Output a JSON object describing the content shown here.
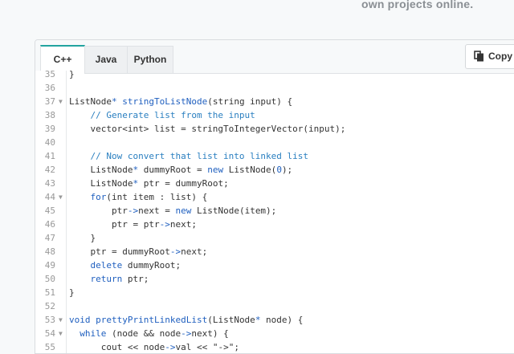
{
  "header_fragment": "own projects online.",
  "tabs": [
    {
      "label": "C++",
      "active": true
    },
    {
      "label": "Java",
      "active": false
    },
    {
      "label": "Python",
      "active": false
    }
  ],
  "copy_label": "Copy",
  "colors": {
    "accent": "#22a39f",
    "keyword": "#1f5fbf",
    "comment": "#2a7fc0"
  },
  "code_lines": [
    {
      "n": "35",
      "fold": false,
      "segs": [
        {
          "t": "}",
          "c": ""
        }
      ]
    },
    {
      "n": "36",
      "fold": false,
      "segs": []
    },
    {
      "n": "37",
      "fold": true,
      "segs": [
        {
          "t": "ListNode",
          "c": ""
        },
        {
          "t": "*",
          "c": "kw"
        },
        {
          "t": " ",
          "c": ""
        },
        {
          "t": "stringToListNode",
          "c": "fn"
        },
        {
          "t": "(string input) {",
          "c": ""
        }
      ]
    },
    {
      "n": "38",
      "fold": false,
      "segs": [
        {
          "t": "    // Generate list from the input",
          "c": "cm"
        }
      ]
    },
    {
      "n": "39",
      "fold": false,
      "segs": [
        {
          "t": "    vector<int> list = stringToIntegerVector(input);",
          "c": ""
        }
      ]
    },
    {
      "n": "40",
      "fold": false,
      "segs": []
    },
    {
      "n": "41",
      "fold": false,
      "segs": [
        {
          "t": "    // Now convert that list into linked list",
          "c": "cm"
        }
      ]
    },
    {
      "n": "42",
      "fold": false,
      "segs": [
        {
          "t": "    ListNode",
          "c": ""
        },
        {
          "t": "*",
          "c": "kw"
        },
        {
          "t": " dummyRoot = ",
          "c": ""
        },
        {
          "t": "new",
          "c": "kw"
        },
        {
          "t": " ListNode(",
          "c": ""
        },
        {
          "t": "0",
          "c": "kw"
        },
        {
          "t": ");",
          "c": ""
        }
      ]
    },
    {
      "n": "43",
      "fold": false,
      "segs": [
        {
          "t": "    ListNode",
          "c": ""
        },
        {
          "t": "*",
          "c": "kw"
        },
        {
          "t": " ptr = dummyRoot;",
          "c": ""
        }
      ]
    },
    {
      "n": "44",
      "fold": true,
      "segs": [
        {
          "t": "    ",
          "c": ""
        },
        {
          "t": "for",
          "c": "kw"
        },
        {
          "t": "(int item : list) {",
          "c": ""
        }
      ]
    },
    {
      "n": "45",
      "fold": false,
      "segs": [
        {
          "t": "        ptr",
          "c": ""
        },
        {
          "t": "->",
          "c": "kw"
        },
        {
          "t": "next = ",
          "c": ""
        },
        {
          "t": "new",
          "c": "kw"
        },
        {
          "t": " ListNode(item);",
          "c": ""
        }
      ]
    },
    {
      "n": "46",
      "fold": false,
      "segs": [
        {
          "t": "        ptr = ptr",
          "c": ""
        },
        {
          "t": "->",
          "c": "kw"
        },
        {
          "t": "next;",
          "c": ""
        }
      ]
    },
    {
      "n": "47",
      "fold": false,
      "segs": [
        {
          "t": "    }",
          "c": ""
        }
      ]
    },
    {
      "n": "48",
      "fold": false,
      "segs": [
        {
          "t": "    ptr = dummyRoot",
          "c": ""
        },
        {
          "t": "->",
          "c": "kw"
        },
        {
          "t": "next;",
          "c": ""
        }
      ]
    },
    {
      "n": "49",
      "fold": false,
      "segs": [
        {
          "t": "    ",
          "c": ""
        },
        {
          "t": "delete",
          "c": "kw"
        },
        {
          "t": " dummyRoot;",
          "c": ""
        }
      ]
    },
    {
      "n": "50",
      "fold": false,
      "segs": [
        {
          "t": "    ",
          "c": ""
        },
        {
          "t": "return",
          "c": "kw"
        },
        {
          "t": " ptr;",
          "c": ""
        }
      ]
    },
    {
      "n": "51",
      "fold": false,
      "segs": [
        {
          "t": "}",
          "c": ""
        }
      ]
    },
    {
      "n": "52",
      "fold": false,
      "segs": []
    },
    {
      "n": "53",
      "fold": true,
      "segs": [
        {
          "t": "void",
          "c": "kw"
        },
        {
          "t": " ",
          "c": ""
        },
        {
          "t": "prettyPrintLinkedList",
          "c": "fn"
        },
        {
          "t": "(ListNode",
          "c": ""
        },
        {
          "t": "*",
          "c": "kw"
        },
        {
          "t": " node) {",
          "c": ""
        }
      ]
    },
    {
      "n": "54",
      "fold": true,
      "segs": [
        {
          "t": "  ",
          "c": ""
        },
        {
          "t": "while",
          "c": "kw"
        },
        {
          "t": " (node && node",
          "c": ""
        },
        {
          "t": "->",
          "c": "kw"
        },
        {
          "t": "next) {",
          "c": ""
        }
      ]
    },
    {
      "n": "55",
      "fold": false,
      "segs": [
        {
          "t": "      cout << node",
          "c": ""
        },
        {
          "t": "->",
          "c": "kw"
        },
        {
          "t": "val << \"->\";",
          "c": ""
        }
      ]
    }
  ]
}
